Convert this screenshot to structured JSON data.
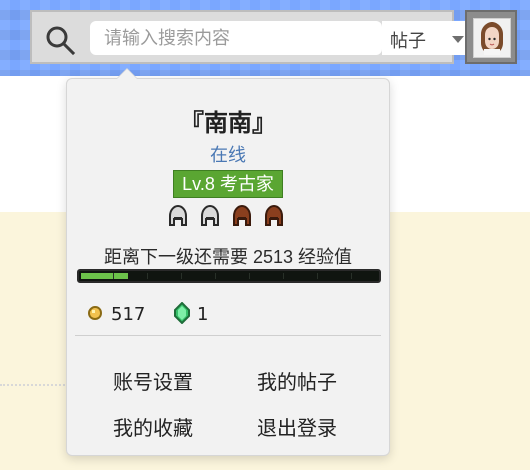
{
  "header": {
    "search": {
      "placeholder": "请输入搜索内容",
      "value": ""
    },
    "scope": {
      "selected": "帖子"
    },
    "avatar": {
      "image_hint": "anime-girl-avatar"
    }
  },
  "popover": {
    "username": "『南南』",
    "status": "在线",
    "level_badge": "Lv.8 考古家",
    "helmets": [
      "iron-helmet-icon",
      "iron-helmet-icon",
      "leather-helmet-icon",
      "leather-helmet-icon"
    ],
    "xp_text": "距离下一级还需要 2513 经验值",
    "xp_progress": 0.16,
    "currency": {
      "gold_value": "517",
      "emerald_value": "1"
    },
    "menu": {
      "account_settings": "账号设置",
      "my_posts": "我的帖子",
      "my_favorites": "我的收藏",
      "logout": "退出登录"
    }
  },
  "colors": {
    "top_bar": "#7aa7ff",
    "page_cream": "#fbf5dc",
    "status_blue": "#4a78b4",
    "level_green": "#5aa632",
    "xp_fill": "#6cc24a"
  }
}
